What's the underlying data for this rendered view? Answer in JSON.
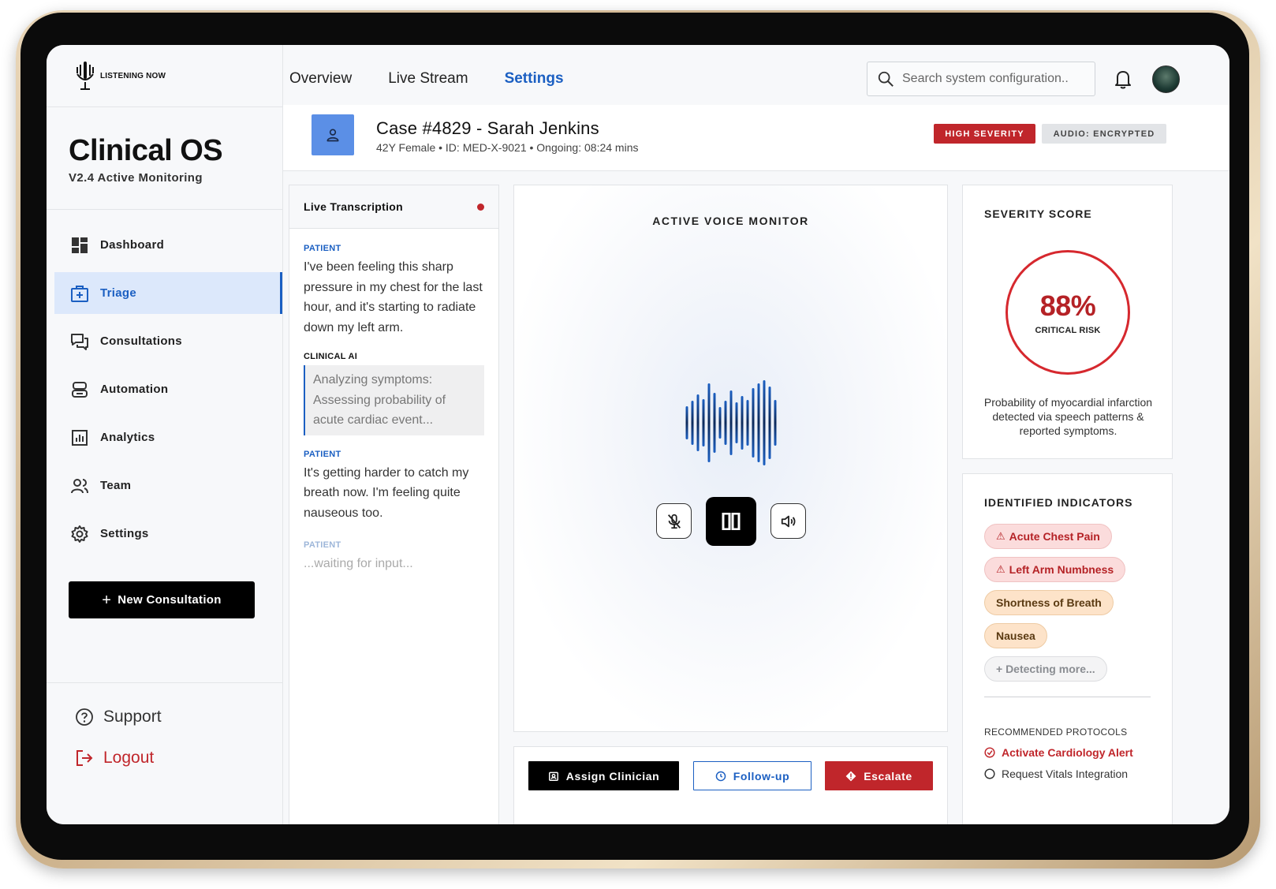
{
  "logo": {
    "text": "LISTENING NOW"
  },
  "brand": {
    "title": "Clinical OS",
    "subtitle": "V2.4 Active Monitoring"
  },
  "sidebar": {
    "items": [
      {
        "label": "Dashboard",
        "icon": "dashboard-icon",
        "active": false
      },
      {
        "label": "Triage",
        "icon": "medical-kit-icon",
        "active": true
      },
      {
        "label": "Consultations",
        "icon": "chat-icon",
        "active": false
      },
      {
        "label": "Automation",
        "icon": "robot-icon",
        "active": false
      },
      {
        "label": "Analytics",
        "icon": "bar-chart-icon",
        "active": false
      },
      {
        "label": "Team",
        "icon": "team-icon",
        "active": false
      },
      {
        "label": "Settings",
        "icon": "gear-icon",
        "active": false
      }
    ],
    "new_button": "New Consultation",
    "support": "Support",
    "logout": "Logout"
  },
  "header": {
    "tabs": [
      {
        "label": "Overview",
        "active": false
      },
      {
        "label": "Live Stream",
        "active": false
      },
      {
        "label": "Settings",
        "active": true
      }
    ],
    "search_placeholder": "Search system configuration.."
  },
  "case": {
    "title": "Case #4829 - Sarah Jenkins",
    "meta": "42Y Female • ID: MED-X-9021 • Ongoing: 08:24 mins",
    "severity_badge": "HIGH SEVERITY",
    "audio_badge": "AUDIO: ENCRYPTED"
  },
  "transcription": {
    "title": "Live Transcription",
    "messages": [
      {
        "speaker": "PATIENT",
        "text": "I've been feeling this sharp pressure in my chest for the last hour, and it's starting to radiate down my left arm."
      },
      {
        "speaker": "CLINICAL AI",
        "text": "Analyzing symptoms: Assessing probability of acute cardiac event..."
      },
      {
        "speaker": "PATIENT",
        "text": "It's getting harder to catch my breath now. I'm feeling quite nauseous too."
      },
      {
        "speaker": "PATIENT",
        "text": "...waiting for input..."
      }
    ]
  },
  "voice_monitor": {
    "title": "ACTIVE VOICE MONITOR"
  },
  "actions": {
    "assign": "Assign Clinician",
    "follow_up": "Follow-up",
    "escalate": "Escalate"
  },
  "severity": {
    "title": "SEVERITY SCORE",
    "score": "88%",
    "score_value": 88,
    "label": "CRITICAL RISK",
    "description": "Probability of myocardial infarction detected via speech patterns & reported symptoms."
  },
  "indicators": {
    "title": "IDENTIFIED INDICATORS",
    "chips": [
      {
        "label": "Acute Chest Pain",
        "level": "critical"
      },
      {
        "label": "Left Arm Numbness",
        "level": "critical"
      },
      {
        "label": "Shortness of Breath",
        "level": "warning"
      },
      {
        "label": "Nausea",
        "level": "warning"
      },
      {
        "label": "+ Detecting more...",
        "level": "pending"
      }
    ],
    "protocols_title": "RECOMMENDED PROTOCOLS",
    "protocols": [
      {
        "label": "Activate Cardiology Alert",
        "checked": true
      },
      {
        "label": "Request Vitals Integration",
        "checked": false
      }
    ]
  },
  "colors": {
    "accent": "#1b5fc2",
    "critical": "#c0262b",
    "warning_bg": "#fde3c9",
    "critical_bg": "#fbdcdc"
  }
}
